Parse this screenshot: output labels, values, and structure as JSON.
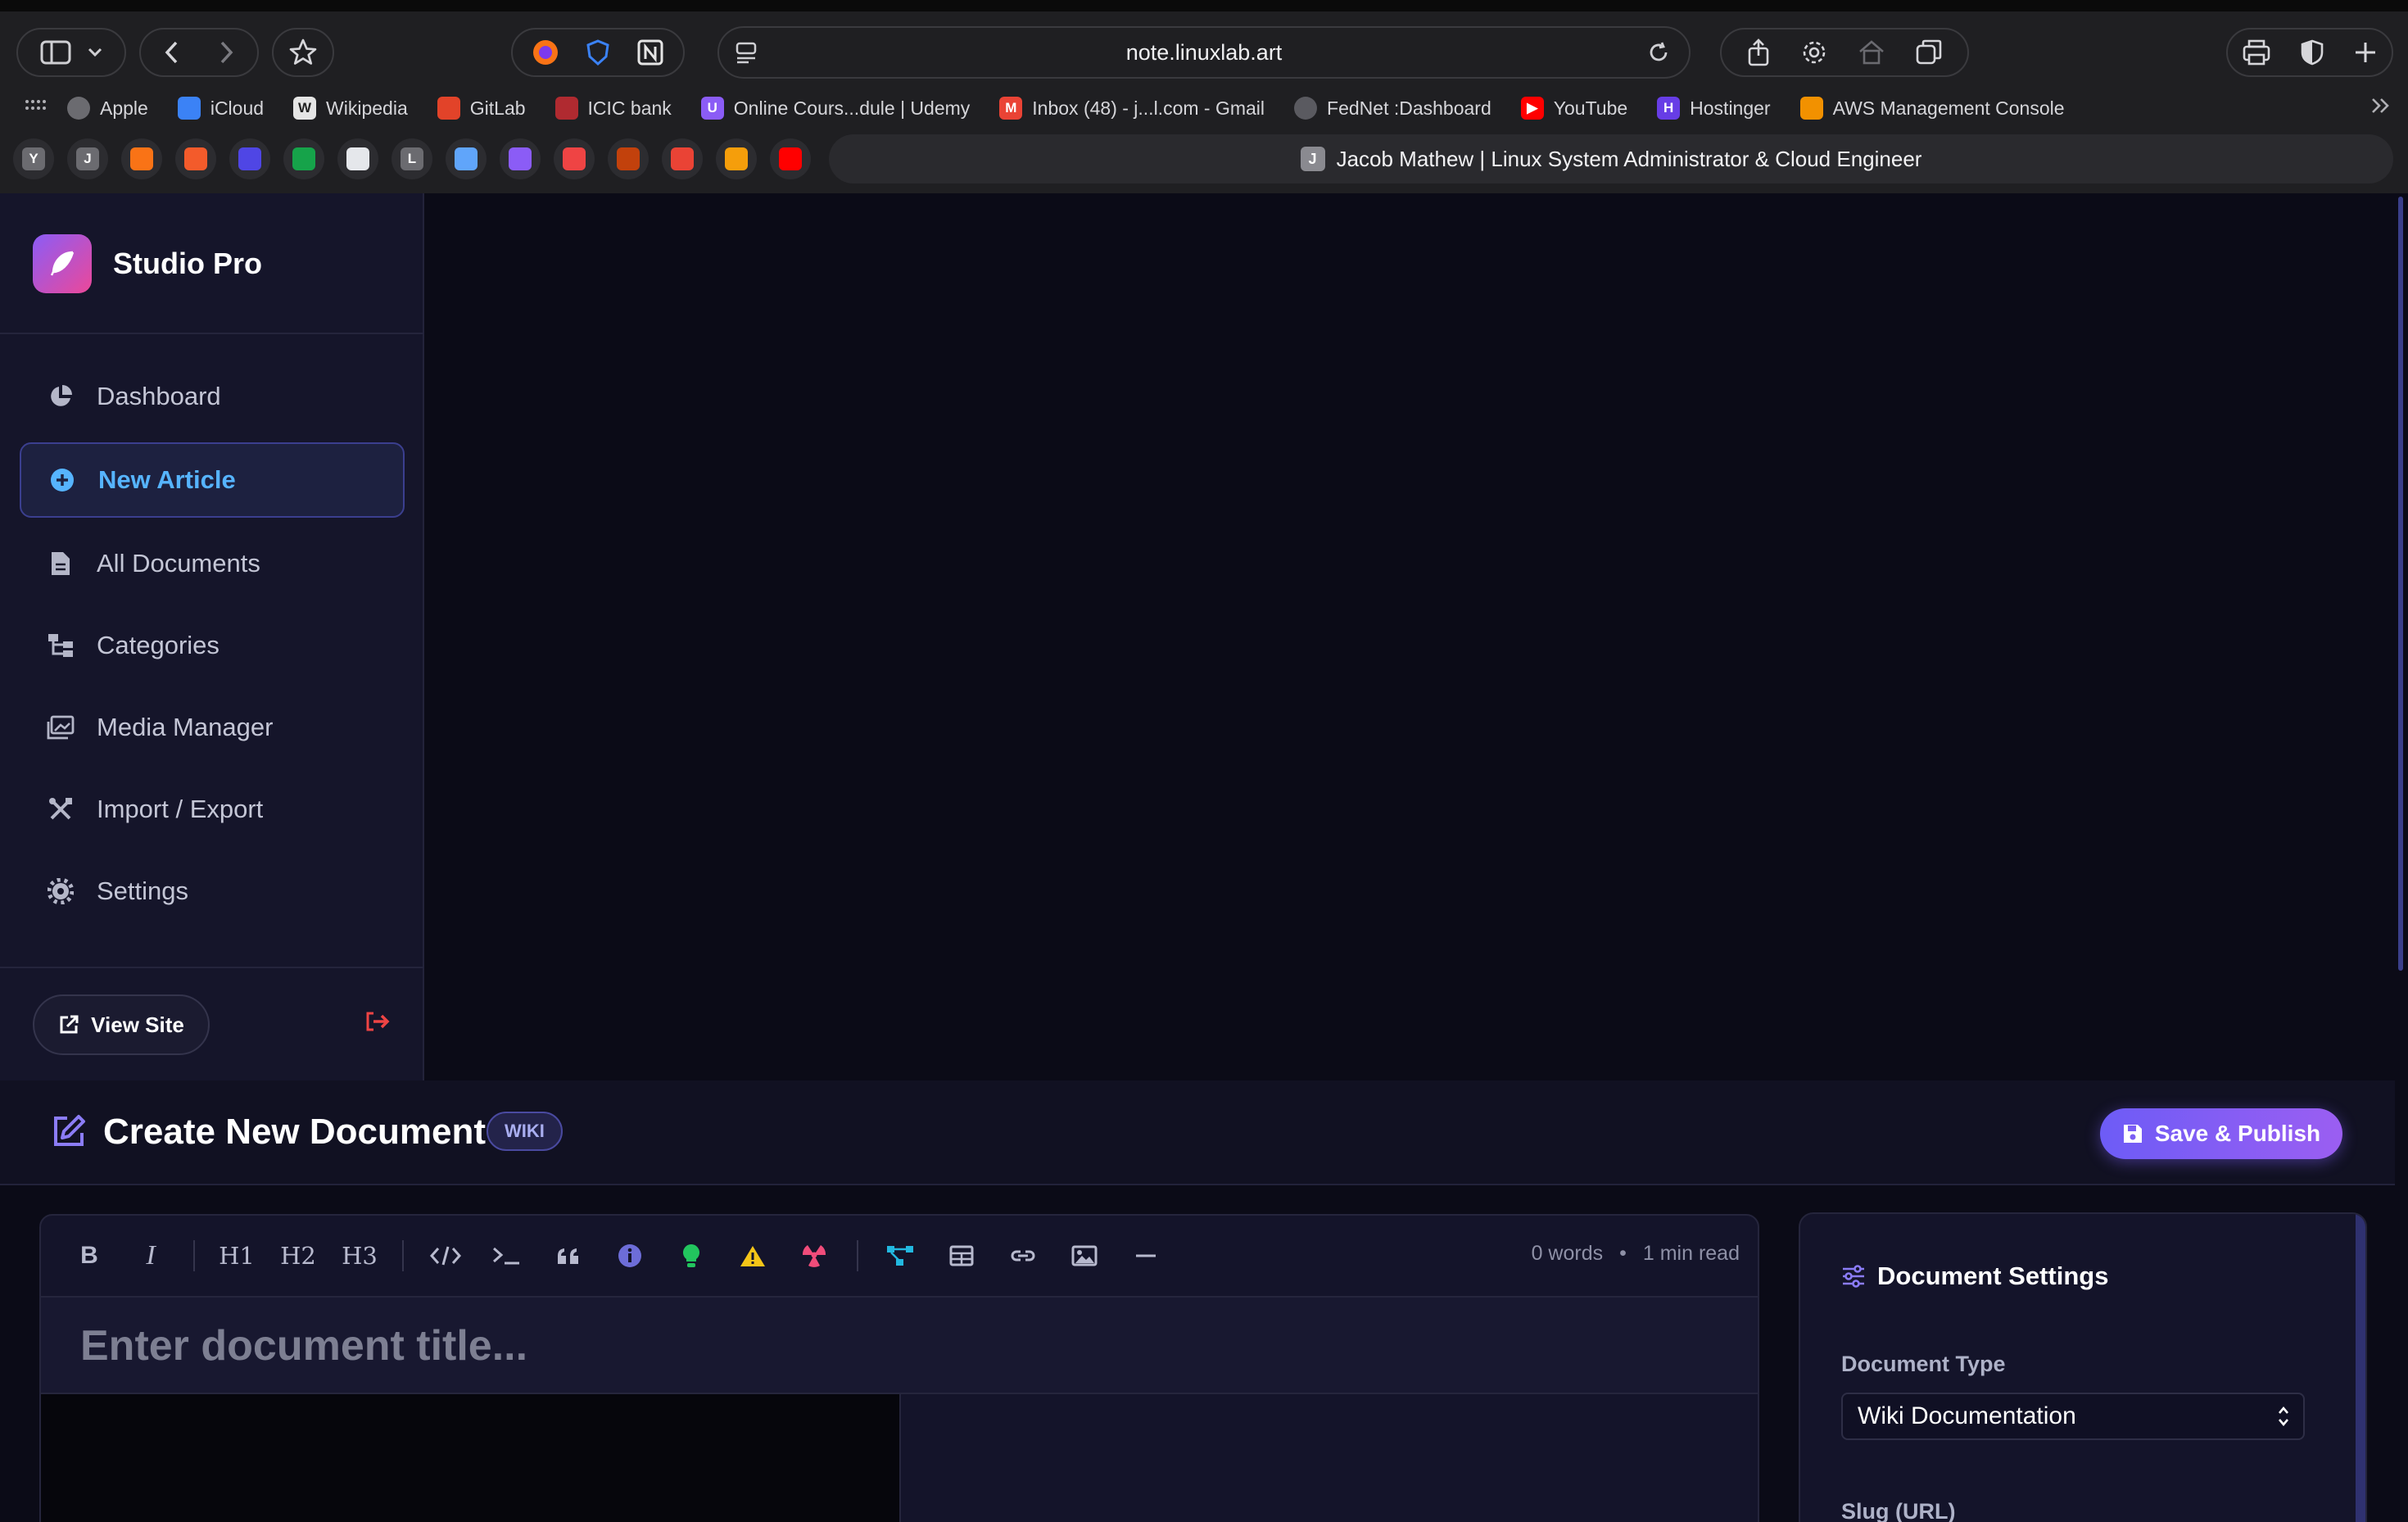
{
  "browser": {
    "url": "note.linuxlab.art",
    "bookmarks": [
      {
        "label": "Apple",
        "icon": "apple-icon",
        "color": "#6b6b70"
      },
      {
        "label": "iCloud",
        "icon": "icloud-icon",
        "color": "#3b82f6"
      },
      {
        "label": "Wikipedia",
        "icon": "wikipedia-icon",
        "color": "#d9d9d9"
      },
      {
        "label": "GitLab",
        "icon": "gitlab-icon",
        "color": "#e24329"
      },
      {
        "label": "ICIC bank",
        "icon": "icic-icon",
        "color": "#b02a30"
      },
      {
        "label": "Online Cours...dule | Udemy",
        "icon": "udemy-icon",
        "color": "#8b5cf6"
      },
      {
        "label": "Inbox (48) - j...l.com - Gmail",
        "icon": "gmail-icon",
        "color": "#ea4335"
      },
      {
        "label": "FedNet :Dashboard",
        "icon": "globe-icon",
        "color": "#5a5a60"
      },
      {
        "label": "YouTube",
        "icon": "youtube-icon",
        "color": "#ff0000"
      },
      {
        "label": "Hostinger",
        "icon": "hostinger-icon",
        "color": "#673de6"
      },
      {
        "label": "AWS Management Console",
        "icon": "aws-icon",
        "color": "#f29100"
      }
    ],
    "pinned_tabs": [
      {
        "glyph": "Y",
        "color": "#6b6b70"
      },
      {
        "glyph": "J",
        "color": "#6b6b70"
      },
      {
        "glyph": "",
        "color": "#f97316"
      },
      {
        "glyph": "",
        "color": "#f35b2b"
      },
      {
        "glyph": "",
        "color": "#4f46e5"
      },
      {
        "glyph": "",
        "color": "#16a34a"
      },
      {
        "glyph": "",
        "color": "#e5e7eb"
      },
      {
        "glyph": "L",
        "color": "#6b6b70"
      },
      {
        "glyph": "",
        "color": "#60a5fa"
      },
      {
        "glyph": "",
        "color": "#8b5cf6"
      },
      {
        "glyph": "",
        "color": "#ef4444"
      },
      {
        "glyph": "",
        "color": "#c2410c"
      },
      {
        "glyph": "",
        "color": "#ea4335"
      },
      {
        "glyph": "",
        "color": "#f59e0b"
      },
      {
        "glyph": "",
        "color": "#ff0000"
      }
    ],
    "active_tab": {
      "favicon": "J",
      "title": "Jacob Mathew | Linux System Administrator & Cloud Engineer"
    }
  },
  "sidebar": {
    "brand": "Studio Pro",
    "items": [
      {
        "label": "Dashboard",
        "icon": "chart-pie-icon"
      },
      {
        "label": "New Article",
        "icon": "plus-circle-icon",
        "active": true
      },
      {
        "label": "All Documents",
        "icon": "file-icon"
      },
      {
        "label": "Categories",
        "icon": "sitemap-icon"
      },
      {
        "label": "Media Manager",
        "icon": "images-icon"
      },
      {
        "label": "Import / Export",
        "icon": "tools-icon"
      },
      {
        "label": "Settings",
        "icon": "gear-icon"
      }
    ],
    "view_site": "View Site"
  },
  "editor": {
    "title": "Create New Document",
    "badge": "WIKI",
    "save_label": "Save & Publish",
    "title_placeholder": "Enter document title...",
    "toolbar": {
      "bold": "B",
      "italic": "I",
      "h1": "H1",
      "h2": "H2",
      "h3": "H3"
    },
    "word_count": "0 words",
    "read_time": "1 min read"
  },
  "settings": {
    "title": "Document Settings",
    "doc_type_label": "Document Type",
    "doc_type_value": "Wiki Documentation",
    "slug_label": "Slug (URL)"
  },
  "colors": {
    "accent": "#6d5cf6",
    "active_nav_text": "#56b4ff",
    "background": "#0b0b17",
    "sidebar": "#15152a"
  }
}
